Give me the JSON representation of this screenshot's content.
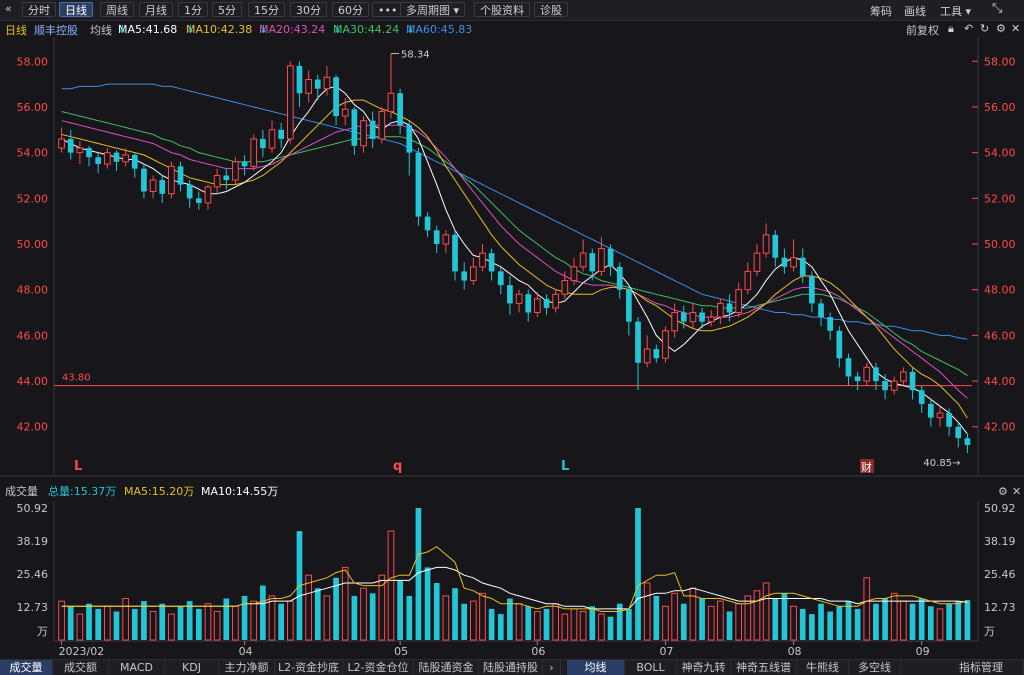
{
  "toolbar": {
    "back_icon": "«",
    "periods": [
      "分时",
      "日线",
      "周线",
      "月线",
      "1分",
      "5分",
      "15分",
      "30分",
      "60分",
      "•••"
    ],
    "active": "日线",
    "multi_period": "多周期图",
    "profile": "个股资料",
    "diagnose": "诊股",
    "right": [
      "筹码",
      "画线",
      "工具"
    ]
  },
  "info": {
    "period": "日线",
    "name": "顺丰控股",
    "ma_label": "均线",
    "ma5": "MA5:41.68",
    "ma10": "MA10:42.38",
    "ma20": "MA20:43.24",
    "ma30": "MA30:44.24",
    "ma60": "MA60:45.83",
    "adjust": "前复权"
  },
  "colors": {
    "up": "#ff4a4a",
    "down": "#22c6d6",
    "ma5": "#ffffff",
    "ma10": "#e8c020",
    "ma20": "#e050c0",
    "ma30": "#40c060",
    "ma60": "#3d8ee8",
    "price_axis": "#ff4a4a"
  },
  "price_axis": [
    "58.00",
    "56.00",
    "54.00",
    "52.00",
    "50.00",
    "48.00",
    "46.00",
    "44.00",
    "42.00"
  ],
  "annotations": {
    "high": "58.34",
    "low": "40.85",
    "hline": "43.80",
    "markers": [
      "L",
      "q",
      "L"
    ],
    "finance_badge": "财"
  },
  "volume": {
    "title": "成交量",
    "total": "总量:15.37万",
    "ma5": "MA5:15.20万",
    "ma10": "MA10:14.55万",
    "axis": [
      "50.92",
      "38.19",
      "25.46",
      "12.73"
    ],
    "unit": "万"
  },
  "date_labels": [
    "2023/02",
    "04",
    "05",
    "06",
    "07",
    "08",
    "09"
  ],
  "tabs_left": [
    "成交量",
    "成交额",
    "MACD",
    "KDJ",
    "主力净额",
    "L2-资金抄底",
    "L2-资金仓位",
    "陆股通资金",
    "陆股通持股"
  ],
  "tabs_right": [
    "均线",
    "BOLL",
    "神奇九转",
    "神奇五线谱",
    "牛熊线",
    "多空线",
    "指标管理"
  ],
  "chart_data": {
    "type": "candlestick",
    "title": "顺丰控股 日线",
    "ylim": [
      40.5,
      58.8
    ],
    "last_close": 40.85,
    "price_range_max": 58.34,
    "support_line": 43.8,
    "candles": [
      [
        54.2,
        54.6,
        54.0,
        55.1
      ],
      [
        54.6,
        54.0,
        53.7,
        55.0
      ],
      [
        54.0,
        54.2,
        53.5,
        54.5
      ],
      [
        54.2,
        53.8,
        53.4,
        54.3
      ],
      [
        53.8,
        53.5,
        53.1,
        54.0
      ],
      [
        53.5,
        54.0,
        53.3,
        54.2
      ],
      [
        54.0,
        53.6,
        53.2,
        54.1
      ],
      [
        53.6,
        53.9,
        53.4,
        54.2
      ],
      [
        53.9,
        53.3,
        52.9,
        54.0
      ],
      [
        53.3,
        52.3,
        52.0,
        53.5
      ],
      [
        52.3,
        52.8,
        52.0,
        53.0
      ],
      [
        52.8,
        52.2,
        51.8,
        53.0
      ],
      [
        52.2,
        53.4,
        52.0,
        53.6
      ],
      [
        53.4,
        52.6,
        52.3,
        53.6
      ],
      [
        52.6,
        52.0,
        51.6,
        52.8
      ],
      [
        52.0,
        51.8,
        51.5,
        52.3
      ],
      [
        51.8,
        52.5,
        51.5,
        52.6
      ],
      [
        52.5,
        53.0,
        52.2,
        53.3
      ],
      [
        53.0,
        52.8,
        52.4,
        53.3
      ],
      [
        52.8,
        53.6,
        52.6,
        53.8
      ],
      [
        53.6,
        53.4,
        53.0,
        53.9
      ],
      [
        53.4,
        54.6,
        53.2,
        54.8
      ],
      [
        54.6,
        54.2,
        53.8,
        55.0
      ],
      [
        54.2,
        55.0,
        54.0,
        55.4
      ],
      [
        55.0,
        54.6,
        54.2,
        55.3
      ],
      [
        54.6,
        57.8,
        54.4,
        58.0
      ],
      [
        57.8,
        56.6,
        56.0,
        58.0
      ],
      [
        56.6,
        57.2,
        56.2,
        57.6
      ],
      [
        57.2,
        56.8,
        56.3,
        57.4
      ],
      [
        56.8,
        57.3,
        56.5,
        57.8
      ],
      [
        57.3,
        55.6,
        55.2,
        57.4
      ],
      [
        55.6,
        55.9,
        55.2,
        56.4
      ],
      [
        55.9,
        54.3,
        53.9,
        56.0
      ],
      [
        54.3,
        55.4,
        54.0,
        55.6
      ],
      [
        55.4,
        54.6,
        54.2,
        55.8
      ],
      [
        54.6,
        55.8,
        54.4,
        56.0
      ],
      [
        55.8,
        56.6,
        55.5,
        58.34
      ],
      [
        56.6,
        55.2,
        54.8,
        56.8
      ],
      [
        55.2,
        54.0,
        53.0,
        55.4
      ],
      [
        54.0,
        51.2,
        50.8,
        54.2
      ],
      [
        51.2,
        50.6,
        50.3,
        51.4
      ],
      [
        50.6,
        50.0,
        49.6,
        50.8
      ],
      [
        50.0,
        50.4,
        49.6,
        50.6
      ],
      [
        50.4,
        48.8,
        48.4,
        50.6
      ],
      [
        48.8,
        48.4,
        48.0,
        49.2
      ],
      [
        48.4,
        49.0,
        48.2,
        49.4
      ],
      [
        49.0,
        49.6,
        48.8,
        50.0
      ],
      [
        49.6,
        48.8,
        48.4,
        49.8
      ],
      [
        48.8,
        48.2,
        47.8,
        49.0
      ],
      [
        48.2,
        47.4,
        46.9,
        48.6
      ],
      [
        47.4,
        47.8,
        47.0,
        48.0
      ],
      [
        47.8,
        47.0,
        46.6,
        48.0
      ],
      [
        47.0,
        47.6,
        46.8,
        47.9
      ],
      [
        47.6,
        47.2,
        46.9,
        47.8
      ],
      [
        47.2,
        47.8,
        47.0,
        48.0
      ],
      [
        47.8,
        48.4,
        47.6,
        48.8
      ],
      [
        48.4,
        49.0,
        48.2,
        49.4
      ],
      [
        49.0,
        49.6,
        48.8,
        50.2
      ],
      [
        49.6,
        48.8,
        48.4,
        49.8
      ],
      [
        48.8,
        49.8,
        48.6,
        50.3
      ],
      [
        49.8,
        49.0,
        48.6,
        50.0
      ],
      [
        49.0,
        48.0,
        47.6,
        49.2
      ],
      [
        48.0,
        46.6,
        46.0,
        48.2
      ],
      [
        46.6,
        44.8,
        43.6,
        46.8
      ],
      [
        44.8,
        45.4,
        44.6,
        46.0
      ],
      [
        45.4,
        45.0,
        44.8,
        45.6
      ],
      [
        45.0,
        46.2,
        44.8,
        46.4
      ],
      [
        46.2,
        47.0,
        45.9,
        47.4
      ],
      [
        47.0,
        46.6,
        46.3,
        47.3
      ],
      [
        46.6,
        47.0,
        46.3,
        47.4
      ],
      [
        47.0,
        46.6,
        46.3,
        47.2
      ],
      [
        46.6,
        46.8,
        46.4,
        47.1
      ],
      [
        46.8,
        47.4,
        46.5,
        47.6
      ],
      [
        47.4,
        47.0,
        46.6,
        47.8
      ],
      [
        47.0,
        48.0,
        46.8,
        48.3
      ],
      [
        48.0,
        48.8,
        47.8,
        49.2
      ],
      [
        48.8,
        49.6,
        48.6,
        50.0
      ],
      [
        49.6,
        50.4,
        49.4,
        50.9
      ],
      [
        50.4,
        49.4,
        49.0,
        50.6
      ],
      [
        49.4,
        49.0,
        48.7,
        49.8
      ],
      [
        49.0,
        49.4,
        48.8,
        50.2
      ],
      [
        49.4,
        48.6,
        48.3,
        49.8
      ],
      [
        48.6,
        47.4,
        47.0,
        48.8
      ],
      [
        47.4,
        46.8,
        46.4,
        47.6
      ],
      [
        46.8,
        46.2,
        45.8,
        47.0
      ],
      [
        46.2,
        45.0,
        44.6,
        46.4
      ],
      [
        45.0,
        44.2,
        43.8,
        45.2
      ],
      [
        44.2,
        44.0,
        43.6,
        44.4
      ],
      [
        44.0,
        44.6,
        43.8,
        44.8
      ],
      [
        44.6,
        44.0,
        43.6,
        44.8
      ],
      [
        44.0,
        43.6,
        43.2,
        44.3
      ],
      [
        43.6,
        44.0,
        43.4,
        44.2
      ],
      [
        44.0,
        44.4,
        43.8,
        44.6
      ],
      [
        44.4,
        43.6,
        43.2,
        44.6
      ],
      [
        43.6,
        43.0,
        42.6,
        43.8
      ],
      [
        43.0,
        42.4,
        42.0,
        43.2
      ],
      [
        42.4,
        42.6,
        42.0,
        42.9
      ],
      [
        42.6,
        42.0,
        41.6,
        42.8
      ],
      [
        42.0,
        41.5,
        41.1,
        42.2
      ],
      [
        41.5,
        41.2,
        40.85,
        41.7
      ]
    ],
    "ma5": [
      54.6,
      54.4,
      54.2,
      54.1,
      54.0,
      53.9,
      53.8,
      53.7,
      53.7,
      53.5,
      53.3,
      53.0,
      52.8,
      52.7,
      52.6,
      52.4,
      52.2,
      52.2,
      52.3,
      52.5,
      52.7,
      53.0,
      53.3,
      53.6,
      54.0,
      54.7,
      55.3,
      55.8,
      56.4,
      56.8,
      56.9,
      56.6,
      56.1,
      55.8,
      55.2,
      55.0,
      55.3,
      55.4,
      55.2,
      54.6,
      53.6,
      52.6,
      51.5,
      50.6,
      50.0,
      49.5,
      49.4,
      49.2,
      49.0,
      48.7,
      48.4,
      48.2,
      47.8,
      47.5,
      47.4,
      47.5,
      47.9,
      48.3,
      48.6,
      48.9,
      49.1,
      48.7,
      48.2,
      47.5,
      46.8,
      46.0,
      45.6,
      45.3,
      45.6,
      46.0,
      46.4,
      46.6,
      46.8,
      46.9,
      47.1,
      47.4,
      47.8,
      48.4,
      48.9,
      49.2,
      49.4,
      49.3,
      49.0,
      48.4,
      47.8,
      47.0,
      46.2,
      45.6,
      45.0,
      44.4,
      44.1,
      43.9,
      43.8,
      43.7,
      43.5,
      43.2,
      42.9,
      42.6,
      42.2,
      41.68
    ],
    "ma10": [
      54.8,
      54.7,
      54.6,
      54.5,
      54.4,
      54.3,
      54.2,
      54.1,
      54.0,
      53.9,
      53.7,
      53.5,
      53.3,
      53.1,
      52.9,
      52.8,
      52.7,
      52.6,
      52.6,
      52.6,
      52.7,
      52.8,
      53.0,
      53.3,
      53.6,
      54.0,
      54.4,
      54.8,
      55.2,
      55.6,
      56.0,
      56.2,
      56.3,
      56.3,
      56.1,
      55.9,
      55.8,
      55.6,
      55.4,
      55.1,
      54.7,
      54.1,
      53.4,
      52.8,
      52.2,
      51.6,
      51.0,
      50.4,
      49.9,
      49.5,
      49.1,
      48.8,
      48.5,
      48.2,
      48.0,
      47.9,
      47.8,
      47.8,
      47.8,
      48.0,
      48.1,
      48.1,
      48.0,
      47.8,
      47.5,
      47.3,
      47.0,
      46.7,
      46.5,
      46.3,
      46.2,
      46.2,
      46.3,
      46.4,
      46.6,
      46.8,
      47.1,
      47.4,
      47.8,
      48.1,
      48.4,
      48.6,
      48.6,
      48.5,
      48.3,
      48.0,
      47.6,
      47.2,
      46.8,
      46.4,
      45.9,
      45.4,
      45.0,
      44.6,
      44.3,
      44.1,
      43.8,
      43.4,
      43.0,
      42.38
    ],
    "ma20": [
      55.4,
      55.3,
      55.2,
      55.1,
      55.0,
      54.9,
      54.8,
      54.7,
      54.6,
      54.5,
      54.4,
      54.2,
      54.0,
      53.9,
      53.7,
      53.6,
      53.5,
      53.4,
      53.3,
      53.3,
      53.3,
      53.3,
      53.4,
      53.5,
      53.7,
      53.9,
      54.1,
      54.3,
      54.5,
      54.7,
      54.9,
      55.0,
      55.1,
      55.2,
      55.2,
      55.2,
      55.2,
      55.2,
      55.1,
      54.9,
      54.6,
      54.2,
      53.8,
      53.3,
      52.8,
      52.3,
      51.8,
      51.3,
      50.8,
      50.4,
      50.0,
      49.7,
      49.4,
      49.1,
      48.8,
      48.6,
      48.4,
      48.3,
      48.2,
      48.2,
      48.2,
      48.1,
      48.0,
      47.8,
      47.6,
      47.4,
      47.3,
      47.1,
      47.0,
      46.9,
      46.8,
      46.8,
      46.8,
      46.8,
      46.9,
      47.0,
      47.2,
      47.4,
      47.6,
      47.8,
      48.0,
      48.1,
      48.1,
      48.0,
      47.9,
      47.7,
      47.4,
      47.1,
      46.8,
      46.5,
      46.2,
      45.9,
      45.6,
      45.3,
      45.0,
      44.7,
      44.4,
      44.0,
      43.6,
      43.24
    ],
    "ma30": [
      55.8,
      55.7,
      55.6,
      55.5,
      55.4,
      55.3,
      55.2,
      55.1,
      55.0,
      54.9,
      54.8,
      54.6,
      54.5,
      54.3,
      54.2,
      54.0,
      53.9,
      53.8,
      53.7,
      53.6,
      53.6,
      53.6,
      53.6,
      53.7,
      53.8,
      53.9,
      54.0,
      54.1,
      54.2,
      54.3,
      54.4,
      54.5,
      54.6,
      54.6,
      54.7,
      54.7,
      54.7,
      54.7,
      54.6,
      54.4,
      54.2,
      53.9,
      53.6,
      53.3,
      52.9,
      52.6,
      52.2,
      51.8,
      51.4,
      51.0,
      50.6,
      50.3,
      50.0,
      49.7,
      49.4,
      49.2,
      48.9,
      48.7,
      48.6,
      48.4,
      48.3,
      48.2,
      48.1,
      48.0,
      47.9,
      47.8,
      47.7,
      47.6,
      47.5,
      47.4,
      47.3,
      47.3,
      47.2,
      47.2,
      47.2,
      47.2,
      47.3,
      47.4,
      47.5,
      47.6,
      47.7,
      47.8,
      47.8,
      47.8,
      47.7,
      47.6,
      47.4,
      47.2,
      47.0,
      46.7,
      46.4,
      46.1,
      45.8,
      45.6,
      45.3,
      45.1,
      44.9,
      44.7,
      44.5,
      44.24
    ],
    "ma60": [
      56.8,
      56.8,
      56.9,
      56.9,
      56.9,
      57.0,
      57.0,
      57.0,
      57.0,
      57.0,
      57.0,
      56.9,
      56.9,
      56.8,
      56.7,
      56.6,
      56.5,
      56.4,
      56.3,
      56.2,
      56.1,
      56.0,
      55.9,
      55.8,
      55.7,
      55.6,
      55.5,
      55.4,
      55.3,
      55.2,
      55.1,
      55.0,
      54.9,
      54.8,
      54.7,
      54.6,
      54.5,
      54.4,
      54.2,
      54.0,
      53.8,
      53.6,
      53.4,
      53.2,
      53.0,
      52.8,
      52.6,
      52.4,
      52.2,
      52.0,
      51.8,
      51.6,
      51.4,
      51.2,
      51.0,
      50.8,
      50.6,
      50.4,
      50.2,
      50.0,
      49.8,
      49.6,
      49.4,
      49.2,
      49.0,
      48.8,
      48.6,
      48.4,
      48.2,
      48.0,
      47.8,
      47.7,
      47.6,
      47.5,
      47.4,
      47.3,
      47.2,
      47.1,
      47.0,
      47.0,
      46.9,
      46.9,
      46.8,
      46.8,
      46.7,
      46.7,
      46.6,
      46.6,
      46.5,
      46.5,
      46.4,
      46.4,
      46.3,
      46.2,
      46.2,
      46.1,
      46.0,
      46.0,
      45.9,
      45.83
    ],
    "volumes": [
      15,
      13,
      10,
      14,
      12,
      13,
      11,
      16,
      12,
      15,
      11,
      14,
      10,
      13,
      15,
      12,
      14,
      11,
      16,
      13,
      17,
      15,
      21,
      17,
      14,
      15,
      42,
      25,
      20,
      17,
      24,
      28,
      17,
      20,
      18,
      25,
      42,
      23,
      17,
      60,
      28,
      22,
      17,
      20,
      14,
      15,
      18,
      12,
      10,
      16,
      14,
      13,
      11,
      12,
      14,
      10,
      12,
      11,
      13,
      10,
      9,
      14,
      12,
      60,
      22,
      17,
      13,
      18,
      14,
      20,
      16,
      13,
      15,
      11,
      14,
      17,
      19,
      22,
      16,
      18,
      13,
      12,
      10,
      14,
      11,
      13,
      15,
      12,
      24,
      14,
      16,
      18,
      15,
      14,
      16,
      13,
      12,
      14,
      15,
      15.37
    ],
    "vol_ma5": [
      13,
      13,
      13,
      13,
      13,
      13,
      13,
      13,
      13,
      13,
      13,
      13,
      13,
      13,
      13,
      13,
      13,
      13,
      13,
      13,
      14,
      14,
      15,
      16,
      16,
      17,
      21,
      22,
      23,
      24,
      26,
      27,
      22,
      21,
      21,
      21,
      24,
      25,
      25,
      33,
      34,
      36,
      33,
      30,
      20,
      19,
      17,
      16,
      14,
      14,
      14,
      13,
      12,
      13,
      13,
      12,
      12,
      12,
      12,
      11,
      11,
      11,
      12,
      21,
      23,
      25,
      25,
      26,
      17,
      17,
      16,
      16,
      16,
      15,
      14,
      14,
      15,
      17,
      18,
      18,
      18,
      17,
      16,
      15,
      14,
      13,
      13,
      13,
      15,
      16,
      16,
      17,
      17,
      17,
      16,
      15,
      14,
      14,
      14,
      15.2
    ],
    "vol_ma10": [
      13,
      13,
      13,
      13,
      13,
      13,
      13,
      13,
      13,
      13,
      13,
      13,
      13,
      13,
      13,
      13,
      13,
      13,
      13,
      13,
      14,
      14,
      14,
      15,
      15,
      15,
      17,
      18,
      19,
      20,
      21,
      22,
      22,
      22,
      22,
      23,
      23,
      23,
      23,
      26,
      27,
      28,
      28,
      27,
      25,
      24,
      22,
      21,
      20,
      18,
      17,
      16,
      15,
      14,
      14,
      13,
      13,
      13,
      12,
      12,
      12,
      12,
      12,
      16,
      17,
      18,
      18,
      19,
      19,
      20,
      19,
      18,
      17,
      16,
      15,
      15,
      15,
      16,
      16,
      16,
      16,
      16,
      16,
      16,
      15,
      15,
      15,
      14,
      15,
      15,
      15,
      15,
      15,
      15,
      15,
      15,
      15,
      15,
      15,
      14.55
    ]
  }
}
